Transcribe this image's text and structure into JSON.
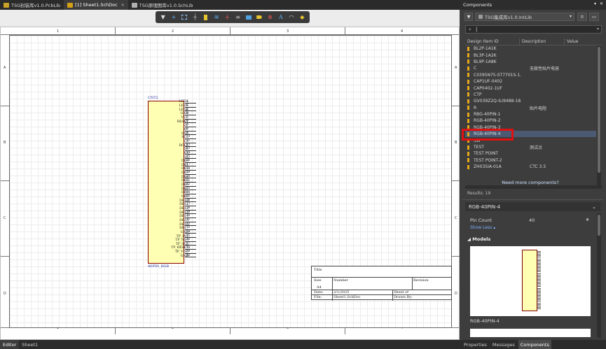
{
  "doc_tabs": [
    {
      "label": "TSG封装库v1.0.PcbLib",
      "color": "#c9a227"
    },
    {
      "label": "[1] Sheet1.SchDoc",
      "color": "#d4a017",
      "active": true
    },
    {
      "label": "TSG原理图库v1.0.SchLib",
      "color": "#b0b0b0"
    }
  ],
  "toolbar_icons": [
    "filter-icon",
    "cross-icon",
    "rect-select-icon",
    "move-icon",
    "part-icon",
    "bus-icon",
    "power-port-icon",
    "net-label-icon",
    "sheet-symbol-icon",
    "port-icon",
    "no-erc-icon",
    "text-icon",
    "arc-icon",
    "harness-icon"
  ],
  "zones": {
    "cols": [
      "1",
      "2",
      "3",
      "4"
    ],
    "rows": [
      "A",
      "B",
      "C",
      "D"
    ]
  },
  "component": {
    "ref": "CNT2",
    "value": "40PIN_RGB",
    "pins": [
      "LEDA",
      "LEDK",
      "LEDK",
      "GND",
      "VCC",
      "RESET",
      "OP",
      "NC",
      "SDA",
      "SCL",
      "CS",
      "DCLK",
      "DE",
      "VS",
      "HS",
      "DB0",
      "DB1",
      "DB2",
      "DB3",
      "DB4",
      "DB5",
      "DB6",
      "DB7",
      "DB8",
      "DB9",
      "DB10",
      "DB11",
      "DB12",
      "DB13",
      "DB14",
      "DB15",
      "DB16",
      "DB17",
      "GND",
      "TP_INT",
      "TP_SDA",
      "TP_SCL",
      "TP_RESET",
      "TP_VDD",
      "GND"
    ]
  },
  "title_block": {
    "title": "Title",
    "size": "Size",
    "number": "Number",
    "revision": "Revision",
    "a4": "A4",
    "date_label": "Date:",
    "date_value": "2/1/2025",
    "file_label": "File:",
    "file_value": "Sheet1.SchDoc",
    "sheet_label": "Sheet   of",
    "drawn_label": "Drawn By:"
  },
  "status_tabs": [
    "Editor",
    "Sheet1"
  ],
  "panel": {
    "title": "Components",
    "library": "TSG集成库v1.0.IntLib",
    "columns": [
      "Design Item ID",
      "Description",
      "Value"
    ],
    "items": [
      {
        "id": "BL2P-1A1K",
        "desc": ""
      },
      {
        "id": "BL3P-1A2K",
        "desc": ""
      },
      {
        "id": "BL9P-1A8K",
        "desc": ""
      },
      {
        "id": "C",
        "desc": "无极性贴片电容"
      },
      {
        "id": "C0395N75-ST7701S-1...",
        "desc": ""
      },
      {
        "id": "CAP1UF-0402",
        "desc": ""
      },
      {
        "id": "CAP0402-1UF",
        "desc": ""
      },
      {
        "id": "CTP",
        "desc": ""
      },
      {
        "id": "GV039Z2Q-ILI9488-18...",
        "desc": ""
      },
      {
        "id": "R",
        "desc": "贴片电阻"
      },
      {
        "id": "RBG-40PIN-1",
        "desc": ""
      },
      {
        "id": "RGB-40PIN-2",
        "desc": ""
      },
      {
        "id": "RGB-40PIN-3",
        "desc": ""
      },
      {
        "id": "RGB-40PIN-4",
        "desc": "",
        "selected": true
      },
      {
        "id": "SW",
        "desc": ""
      },
      {
        "id": "TEST",
        "desc": "测试点"
      },
      {
        "id": "TEST POINT",
        "desc": ""
      },
      {
        "id": "TEST POINT-2",
        "desc": ""
      },
      {
        "id": "ZH035IA-01A",
        "desc": "CTC 3.5"
      }
    ],
    "more": "Need more components?",
    "results": "Results: 19",
    "detail_title": "RGB-40PIN-4",
    "pin_count_label": "Pin Count",
    "pin_count_value": "40",
    "show_less": "Show Less ▴",
    "models_label": "Models",
    "model_name": "RGB-40PIN-4"
  },
  "panel_tabs": [
    "Properties",
    "Messages",
    "Components"
  ],
  "colors": {
    "accent": "#e01010",
    "folder": "#e6a817",
    "symbol_fill": "#ffffb3"
  }
}
